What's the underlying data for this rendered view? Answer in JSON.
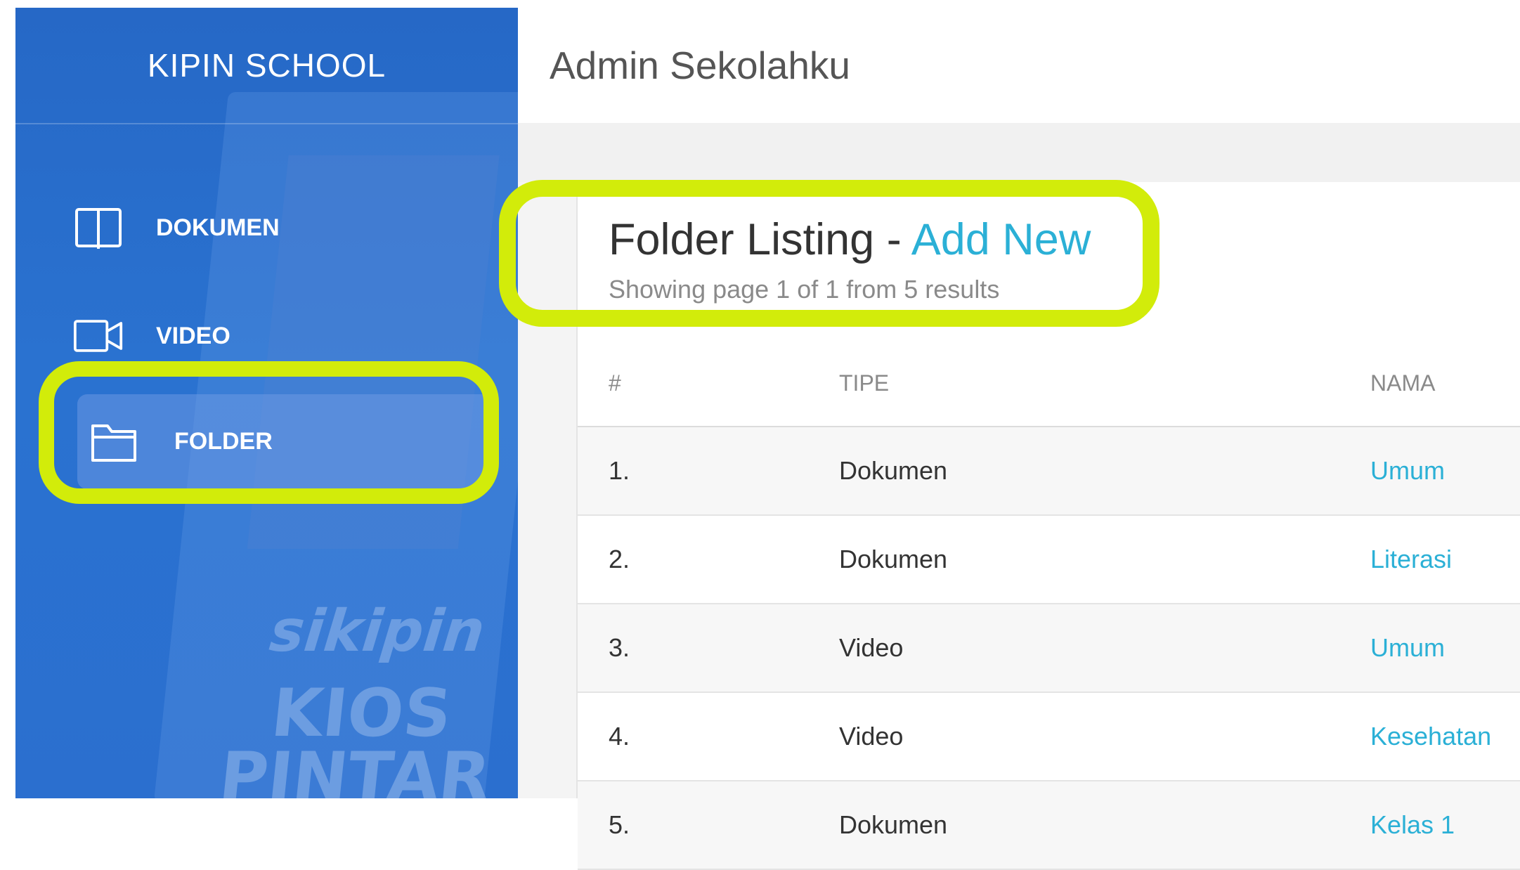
{
  "sidebar": {
    "brand": "KIPIN SCHOOL",
    "items": [
      {
        "label": "DOKUMEN",
        "icon": "book-icon"
      },
      {
        "label": "VIDEO",
        "icon": "video-camera-icon"
      },
      {
        "label": "FOLDER",
        "icon": "folder-icon",
        "active": true
      }
    ],
    "background_text": [
      "sikipin",
      "KIOS",
      "PINTAR"
    ]
  },
  "header": {
    "title": "Admin Sekolahku"
  },
  "page": {
    "title": "Folder Listing",
    "separator": " - ",
    "add_new": "Add New",
    "subtitle": "Showing page 1 of 1 from 5 results"
  },
  "table": {
    "columns": [
      "#",
      "TIPE",
      "NAMA"
    ],
    "rows": [
      {
        "no": "1.",
        "tipe": "Dokumen",
        "nama": "Umum"
      },
      {
        "no": "2.",
        "tipe": "Dokumen",
        "nama": "Literasi"
      },
      {
        "no": "3.",
        "tipe": "Video",
        "nama": "Umum"
      },
      {
        "no": "4.",
        "tipe": "Video",
        "nama": "Kesehatan"
      },
      {
        "no": "5.",
        "tipe": "Dokumen",
        "nama": "Kelas 1"
      }
    ]
  },
  "colors": {
    "sidebar": "#2a6fcf",
    "accent_link": "#2bb0d6",
    "highlight": "#d2ec0a"
  }
}
